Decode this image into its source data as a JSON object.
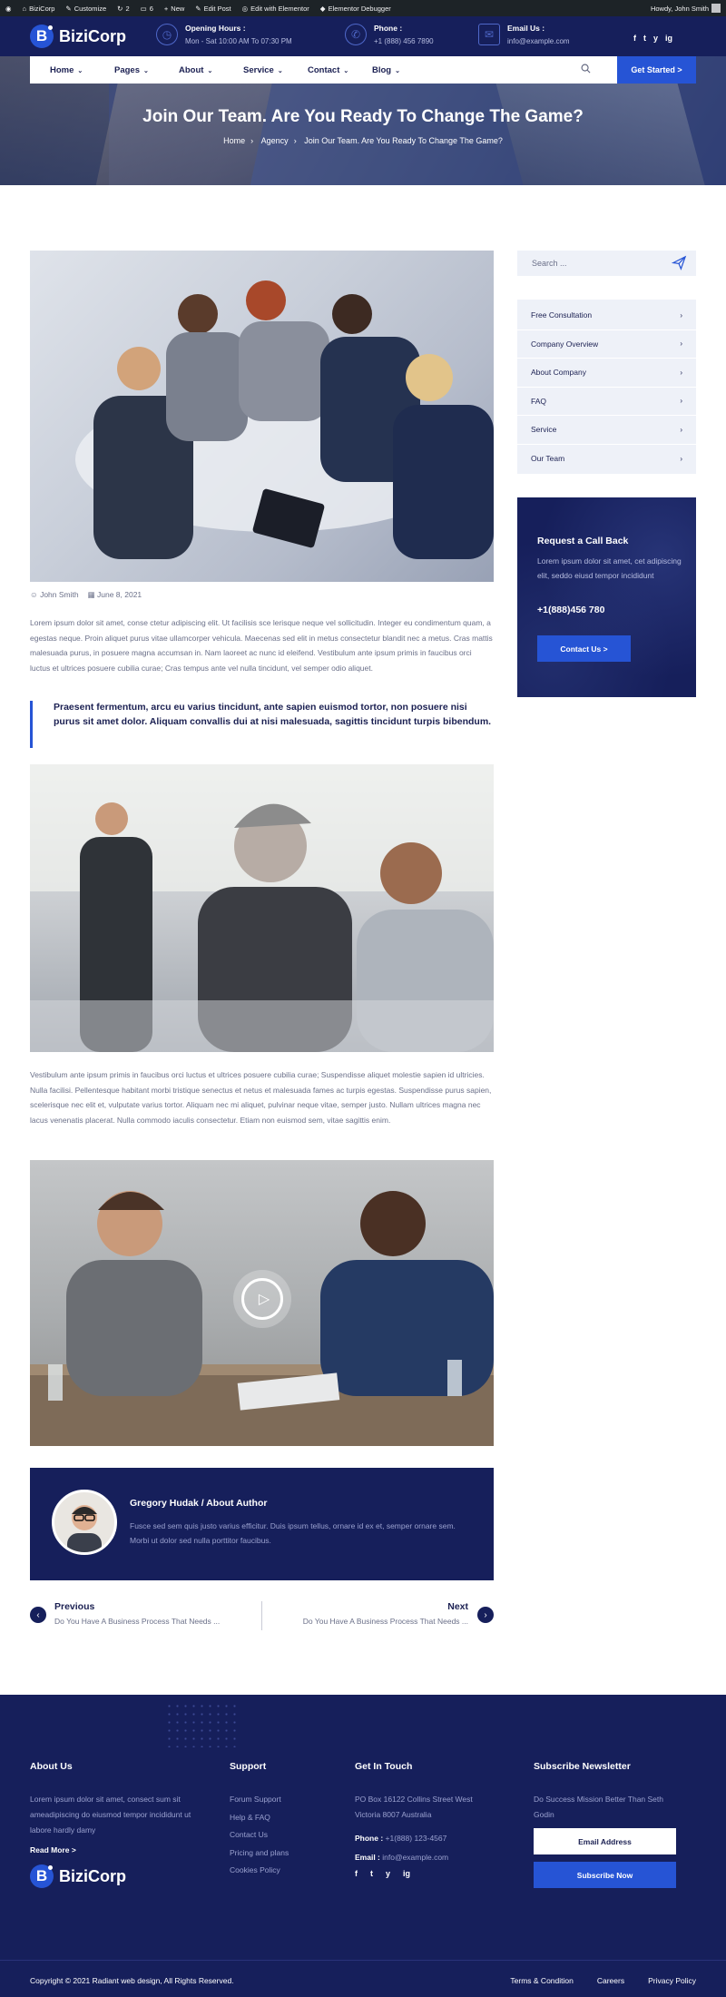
{
  "adminbar": {
    "site": "BiziCorp",
    "customize": "Customize",
    "updates": "2",
    "comments": "6",
    "new": "New",
    "edit_post": "Edit Post",
    "edit_elementor": "Edit with Elementor",
    "debugger": "Elementor Debugger",
    "howdy": "Howdy, John Smith"
  },
  "header": {
    "logo_letter": "B",
    "logo_text": "BiziCorp",
    "opening_title": "Opening Hours :",
    "opening_value": "Mon - Sat 10:00 AM To 07:30 PM",
    "phone_title": "Phone :",
    "phone_value": "+1 (888) 456 7890",
    "email_title": "Email Us :",
    "email_value": "info@example.com",
    "social": [
      "f",
      "t",
      "y",
      "ig"
    ]
  },
  "nav": {
    "items": [
      "Home",
      "Pages",
      "About",
      "Service",
      "Contact",
      "Blog"
    ],
    "cta": "Get Started >"
  },
  "hero": {
    "title": "Join Our Team. Are You Ready To Change The Game?",
    "crumbs": [
      "Home",
      "Agency",
      "Join Our Team. Are You Ready To Change The Game?"
    ]
  },
  "post": {
    "author": "John Smith",
    "date": "June 8, 2021",
    "para1": "Lorem ipsum dolor sit amet, conse ctetur adipiscing elit. Ut facilisis sce lerisque neque vel sollicitudin. Integer eu condimentum quam, a egestas neque. Proin aliquet purus vitae ullamcorper vehicula. Maecenas sed elit in metus consectetur blandit nec a metus. Cras mattis malesuada purus, in posuere magna accumsan in. Nam laoreet ac nunc id eleifend. Vestibulum ante ipsum primis in faucibus orci luctus et ultrices posuere cubilia curae; Cras tempus ante vel nulla tincidunt, vel semper odio aliquet.",
    "quote": "Praesent fermentum, arcu eu varius tincidunt, ante sapien euismod tortor, non posuere nisi purus sit amet dolor. Aliquam convallis dui at nisi malesuada, sagittis tincidunt turpis bibendum.",
    "para2": "Vestibulum ante ipsum primis in faucibus orci luctus et ultrices posuere cubilia curae; Suspendisse aliquet molestie sapien id ultricies. Nulla facilisi. Pellentesque habitant morbi tristique senectus et netus et malesuada fames ac turpis egestas. Suspendisse purus sapien, scelerisque nec elit et, vulputate varius tortor. Aliquam nec mi aliquet, pulvinar neque vitae, semper justo. Nullam ultrices magna nec lacus venenatis placerat. Nulla commodo iaculis consectetur. Etiam non euismod sem, vitae sagittis enim."
  },
  "author_box": {
    "name": "Gregory Hudak / About Author",
    "bio": "Fusce sed sem quis justo varius efficitur. Duis ipsum tellus, ornare id ex et, semper ornare sem. Morbi ut dolor sed nulla porttitor faucibus."
  },
  "post_nav": {
    "prev_label": "Previous",
    "prev_title": "Do You Have A Business Process That Needs ...",
    "next_label": "Next",
    "next_title": "Do You Have A Business Process That Needs ..."
  },
  "sidebar": {
    "search_placeholder": "Search ...",
    "categories": [
      "Free Consultation",
      "Company Overview",
      "About Company",
      "FAQ",
      "Service",
      "Our Team"
    ],
    "callback_title": "Request a Call Back",
    "callback_text": "Lorem ipsum dolor sit amet, cet adipiscing elit, seddo eiusd tempor incididunt",
    "callback_phone": "+1(888)456 780",
    "callback_button": "Contact Us >"
  },
  "footer": {
    "about_title": "About Us",
    "about_text": "Lorem ipsum dolor sit amet, consect sum sit ameadipiscing do eiusmod tempor incididunt ut labore hardly damy",
    "read_more": "Read More >",
    "support_title": "Support",
    "support_links": [
      "Forum Support",
      "Help & FAQ",
      "Contact Us",
      "Pricing and plans",
      "Cookies Policy"
    ],
    "touch_title": "Get In Touch",
    "address": "PO Box 16122 Collins Street West Victoria 8007 Australia",
    "phone_label": "Phone :",
    "phone_value": "+1(888) 123-4567",
    "email_label": "Email :",
    "email_value": "info@example.com",
    "newsletter_title": "Subscribe Newsletter",
    "newsletter_text": "Do Success Mission Better Than Seth Godin",
    "email_placeholder": "Email Address",
    "subscribe": "Subscribe Now",
    "copyright": "Copyright © 2021 Radiant web design, All Rights Reserved.",
    "bottom_links": [
      "Terms & Condition",
      "Careers",
      "Privacy Policy"
    ]
  },
  "colors": {
    "navy": "#161f5b",
    "accent": "#2654d5"
  }
}
